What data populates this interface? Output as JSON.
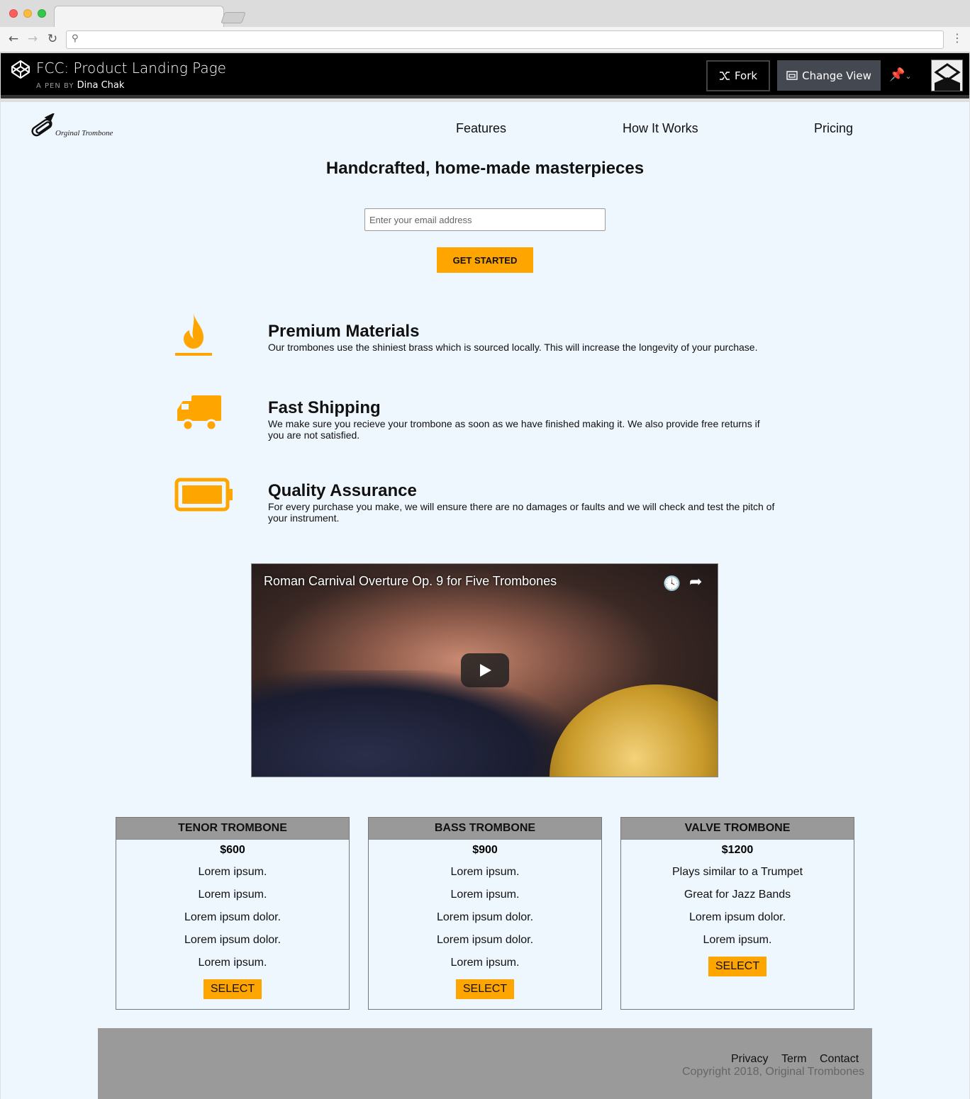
{
  "browser": {
    "url": ""
  },
  "codepen": {
    "title": "FCC: Product Landing Page",
    "by_prefix": "A PEN BY",
    "author": "Dina Chak",
    "fork_label": "Fork",
    "change_view_label": "Change View"
  },
  "site": {
    "logo_text": "Orginal  Trombone",
    "nav": [
      "Features",
      "How It Works",
      "Pricing"
    ],
    "hero_title": "Handcrafted, home-made masterpieces",
    "email_placeholder": "Enter your email address",
    "cta_label": "GET STARTED",
    "features": [
      {
        "title": "Premium Materials",
        "text": "Our trombones use the shiniest brass which is sourced locally. This will increase the longevity of your purchase.",
        "icon": "fire-icon"
      },
      {
        "title": "Fast Shipping",
        "text": "We make sure you recieve your trombone as soon as we have finished making it. We also provide free returns if you are not satisfied.",
        "icon": "truck-icon"
      },
      {
        "title": "Quality Assurance",
        "text": "For every purchase you make, we will ensure there are no damages or faults and we will check and test the pitch of your instrument.",
        "icon": "battery-icon"
      }
    ],
    "video_title": "Roman Carnival Overture Op. 9 for Five Trombones",
    "plans": [
      {
        "name": "TENOR TROMBONE",
        "price": "$600",
        "items": [
          "Lorem ipsum.",
          "Lorem ipsum.",
          "Lorem ipsum dolor.",
          "Lorem ipsum dolor.",
          "Lorem ipsum."
        ],
        "button": "SELECT"
      },
      {
        "name": "BASS TROMBONE",
        "price": "$900",
        "items": [
          "Lorem ipsum.",
          "Lorem ipsum.",
          "Lorem ipsum dolor.",
          "Lorem ipsum dolor.",
          "Lorem ipsum."
        ],
        "button": "SELECT"
      },
      {
        "name": "VALVE TROMBONE",
        "price": "$1200",
        "items": [
          "Plays similar to a Trumpet",
          "Great for Jazz Bands",
          "Lorem ipsum dolor.",
          "Lorem ipsum."
        ],
        "button": "SELECT"
      }
    ],
    "footer": {
      "links": [
        "Privacy",
        "Term",
        "Contact"
      ],
      "copyright": "Copyright 2018, Original Trombones"
    },
    "accent_color": "#ffa500"
  }
}
